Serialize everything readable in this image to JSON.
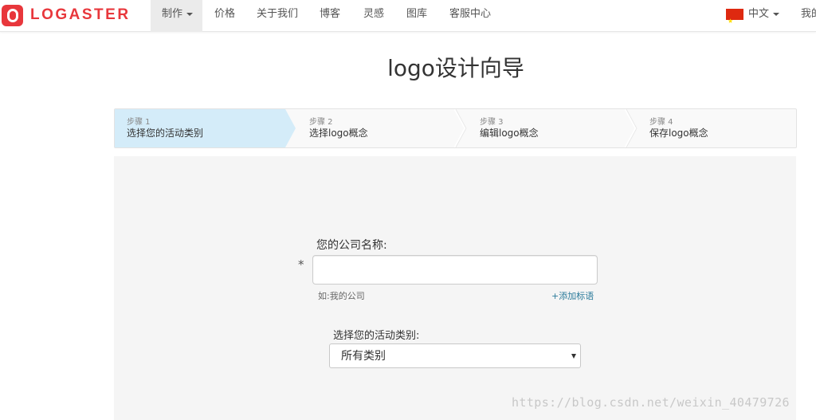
{
  "brand": {
    "name": "LOGASTER",
    "color": "#e8373c"
  },
  "nav": {
    "items": [
      {
        "label": "制作",
        "has_caret": true,
        "active": true
      },
      {
        "label": "价格"
      },
      {
        "label": "关于我们"
      },
      {
        "label": "博客"
      },
      {
        "label": "灵感"
      },
      {
        "label": "图库"
      },
      {
        "label": "客服中心"
      }
    ],
    "language": {
      "label": "中文",
      "flag_icon": "china-flag-icon"
    },
    "account_label": "我的"
  },
  "page": {
    "title": "logo设计向导"
  },
  "steps": [
    {
      "num": "步骤 1",
      "label": "选择您的活动类别",
      "active": true
    },
    {
      "num": "步骤 2",
      "label": "选择logo概念"
    },
    {
      "num": "步骤 3",
      "label": "编辑logo概念"
    },
    {
      "num": "步骤 4",
      "label": "保存logo概念"
    }
  ],
  "form": {
    "company_name": {
      "label": "您的公司名称:",
      "required_mark": "*",
      "value": "",
      "hint": "如:我的公司",
      "add_slogan_label": "+添加标语"
    },
    "category": {
      "label": "选择您的活动类别:",
      "selected": "所有类别"
    }
  },
  "watermark": "https://blog.csdn.net/weixin_40479726",
  "colors": {
    "active_step": "#d4ecf9",
    "panel_bg": "#f5f5f5",
    "link": "#2a7a9a"
  }
}
